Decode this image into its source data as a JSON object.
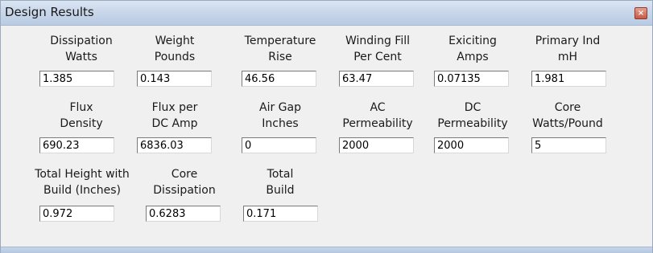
{
  "window": {
    "title": "Design Results",
    "close_glyph": "×"
  },
  "fields": [
    {
      "id": "dissipation-watts",
      "label": "Dissipation\nWatts",
      "value": "1.385"
    },
    {
      "id": "weight-pounds",
      "label": "Weight\nPounds",
      "value": "0.143"
    },
    {
      "id": "temperature-rise",
      "label": "Temperature\nRise",
      "value": "46.56"
    },
    {
      "id": "winding-fill-per-cent",
      "label": "Winding Fill\nPer Cent",
      "value": "63.47"
    },
    {
      "id": "exiciting-amps",
      "label": "Exiciting\nAmps",
      "value": "0.07135"
    },
    {
      "id": "primary-ind-mh",
      "label": "Primary Ind\nmH",
      "value": "1.981"
    },
    {
      "id": "flux-density",
      "label": "Flux\nDensity",
      "value": "690.23"
    },
    {
      "id": "flux-per-dc-amp",
      "label": "Flux per\nDC Amp",
      "value": "6836.03"
    },
    {
      "id": "air-gap-inches",
      "label": "Air Gap\nInches",
      "value": "0"
    },
    {
      "id": "ac-permeability",
      "label": "AC\nPermeability",
      "value": "2000"
    },
    {
      "id": "dc-permeability",
      "label": "DC\nPermeability",
      "value": "2000"
    },
    {
      "id": "core-watts-pound",
      "label": "Core\nWatts/Pound",
      "value": "5"
    },
    {
      "id": "total-height-with-build",
      "label": "Total Height with\nBuild (Inches)",
      "value": "0.972"
    },
    {
      "id": "core-dissipation",
      "label": "Core\nDissipation",
      "value": "0.6283"
    },
    {
      "id": "total-build",
      "label": "Total\nBuild",
      "value": "0.171"
    }
  ]
}
